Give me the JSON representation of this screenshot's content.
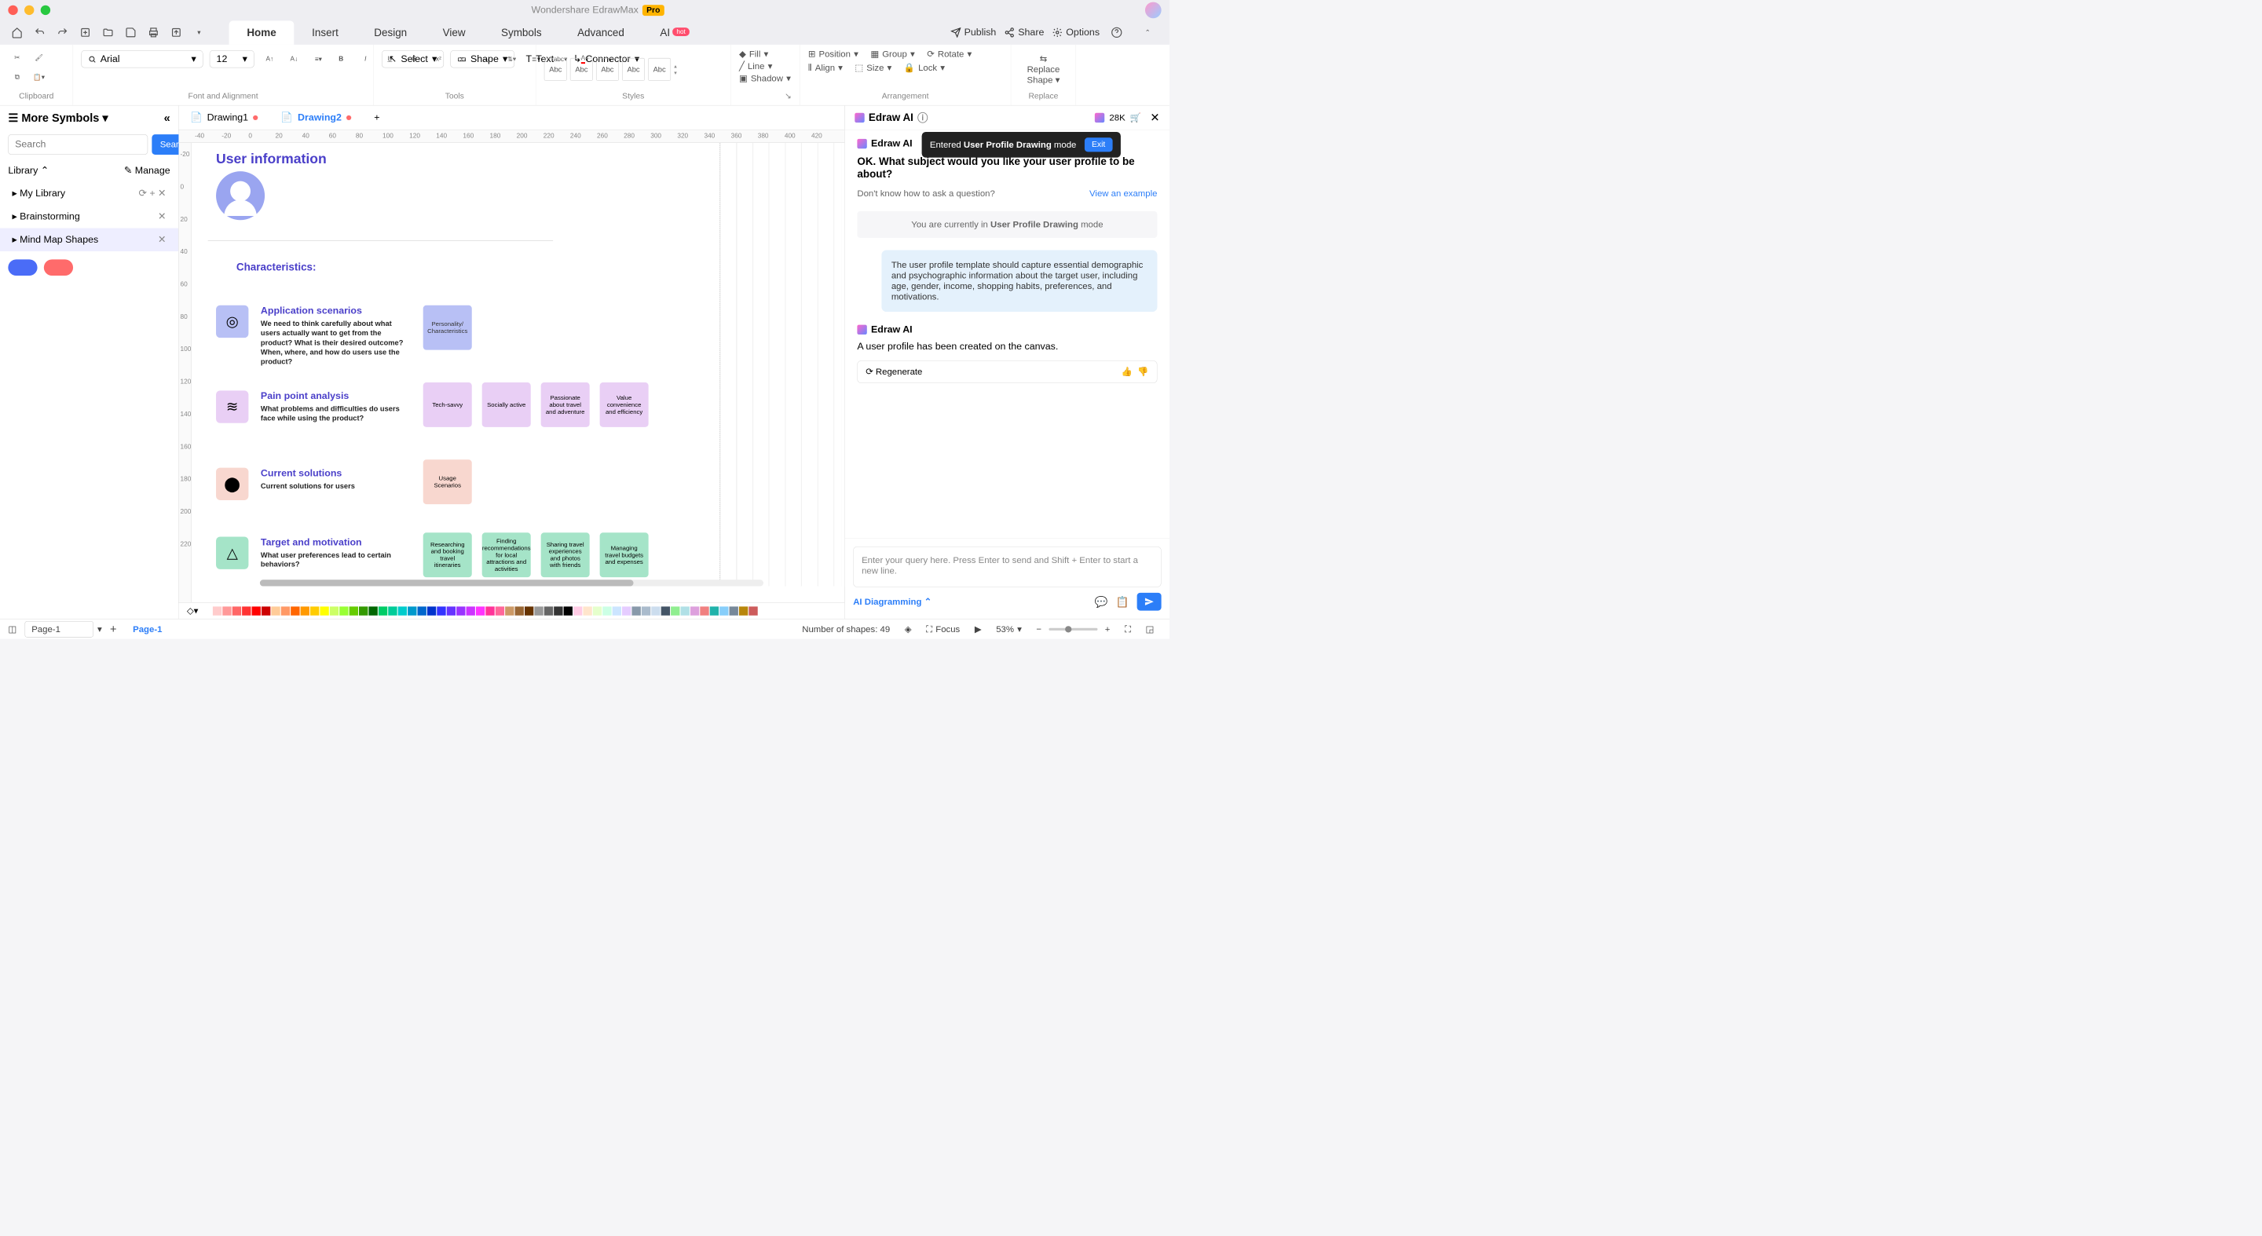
{
  "titlebar": {
    "app": "Wondershare EdrawMax",
    "badge": "Pro"
  },
  "main_tabs": [
    "Home",
    "Insert",
    "Design",
    "View",
    "Symbols",
    "Advanced",
    "AI"
  ],
  "main_tabs_active": 0,
  "ai_hot": "hot",
  "right_actions": {
    "publish": "Publish",
    "share": "Share",
    "options": "Options"
  },
  "ribbon": {
    "clipboard": "Clipboard",
    "font_family": "Arial",
    "font_size": "12",
    "font_label": "Font and Alignment",
    "select": "Select",
    "shape": "Shape",
    "text": "Text",
    "connector": "Connector",
    "tools_label": "Tools",
    "style_preview": "Abc",
    "styles_label": "Styles",
    "fill": "Fill",
    "line": "Line",
    "shadow": "Shadow",
    "position": "Position",
    "align": "Align",
    "group": "Group",
    "size": "Size",
    "rotate": "Rotate",
    "lock": "Lock",
    "arrangement_label": "Arrangement",
    "replace_shape": "Replace\nShape",
    "replace_label": "Replace"
  },
  "leftpanel": {
    "more": "More Symbols",
    "search_ph": "Search",
    "search_btn": "Search",
    "library": "Library",
    "manage": "Manage",
    "items": [
      "My Library",
      "Brainstorming",
      "Mind Map Shapes"
    ],
    "active_item": 2
  },
  "doc_tabs": [
    {
      "name": "Drawing1",
      "modified": true,
      "active": false
    },
    {
      "name": "Drawing2",
      "modified": true,
      "active": true
    }
  ],
  "ruler_h": [
    -40,
    -20,
    0,
    20,
    40,
    60,
    80,
    100,
    120,
    140,
    160,
    180,
    200,
    220,
    240,
    260,
    280,
    300,
    320,
    340,
    360,
    380,
    400,
    420
  ],
  "ruler_v": [
    -20,
    0,
    20,
    40,
    60,
    80,
    100,
    120,
    140,
    160,
    180,
    200,
    220
  ],
  "canvas": {
    "title": "User information",
    "characteristics": "Characteristics:",
    "blocks": [
      {
        "title": "Application scenarios",
        "desc": "We need to think carefully about what users actually want to get from the product? What is their desired outcome? When, where, and how do users use the product?",
        "icon_bg": "#b8c0f5",
        "icon": "◎"
      },
      {
        "title": "Pain point analysis",
        "desc": "What problems and difficulties do users face while using the product?",
        "icon_bg": "#e9cff5",
        "icon": "≋"
      },
      {
        "title": "Current solutions",
        "desc": "Current solutions for users",
        "icon_bg": "#f8d7cf",
        "icon": "⬤"
      },
      {
        "title": "Target and motivation",
        "desc": "What user preferences lead to certain behaviors?",
        "icon_bg": "#a5e4c8",
        "icon": "△"
      }
    ],
    "cards_row1": [
      {
        "t": "Personality/\nCharacteristics",
        "c": "c-blue"
      }
    ],
    "cards_row2": [
      {
        "t": "Tech-savvy",
        "c": "c-pink"
      },
      {
        "t": "Socially active",
        "c": "c-pink"
      },
      {
        "t": "Passionate about travel and adventure",
        "c": "c-pink"
      },
      {
        "t": "Value convenience and efficiency",
        "c": "c-pink"
      }
    ],
    "cards_row3": [
      {
        "t": "Usage Scenarios",
        "c": "c-peach"
      }
    ],
    "cards_row4": [
      {
        "t": "Researching and booking travel itineraries",
        "c": "c-green"
      },
      {
        "t": "Finding recommendations for local attractions and activities",
        "c": "c-green"
      },
      {
        "t": "Sharing travel experiences and photos with friends",
        "c": "c-green"
      },
      {
        "t": "Managing travel budgets and expenses",
        "c": "c-green"
      }
    ]
  },
  "ai": {
    "title": "Edraw AI",
    "tokens": "28K",
    "toast_pre": "Entered ",
    "toast_b": "User Profile Drawing",
    "toast_post": " mode",
    "exit": "Exit",
    "name": "Edraw AI",
    "question": "OK. What subject would you like your user profile to be about?",
    "hint": "Don't know how to ask a question?",
    "example": "View an example",
    "banner_pre": "You are currently in ",
    "banner_b": "User Profile Drawing",
    "banner_post": " mode",
    "user_msg": "The user profile template should capture essential demographic and psychographic information about the target user, including age, gender, income, shopping habits, preferences, and motivations.",
    "reply": "A user profile has been created on the canvas.",
    "regenerate": "Regenerate",
    "input_ph": "Enter your query here. Press Enter to send and Shift + Enter to start a new line.",
    "mode": "AI Diagramming"
  },
  "statusbar": {
    "page_dd": "Page-1",
    "page_tab": "Page-1",
    "shapes": "Number of shapes: 49",
    "focus": "Focus",
    "zoom": "53%"
  },
  "colors": [
    "#ffffff",
    "#ffcccc",
    "#ff9999",
    "#ff6666",
    "#ff3333",
    "#ff0000",
    "#cc0000",
    "#ffcc99",
    "#ff9966",
    "#ff6600",
    "#ff9900",
    "#ffcc00",
    "#ffff00",
    "#ccff66",
    "#99ff33",
    "#66cc00",
    "#339900",
    "#006600",
    "#00cc66",
    "#00cc99",
    "#00cccc",
    "#0099cc",
    "#0066cc",
    "#0033cc",
    "#3333ff",
    "#6633ff",
    "#9933ff",
    "#cc33ff",
    "#ff33ff",
    "#ff3399",
    "#ff6699",
    "#cc9966",
    "#996633",
    "#663300",
    "#999999",
    "#666666",
    "#333333",
    "#000000",
    "#ffcce5",
    "#ffe5cc",
    "#e5ffcc",
    "#ccffe5",
    "#cce5ff",
    "#e5ccff",
    "#8899aa",
    "#aabbcc",
    "#ccddee",
    "#445566",
    "#90ee90",
    "#b0e0e6",
    "#dda0dd",
    "#f08080",
    "#20b2aa",
    "#87cefa",
    "#778899",
    "#b8860b",
    "#cd5c5c"
  ]
}
